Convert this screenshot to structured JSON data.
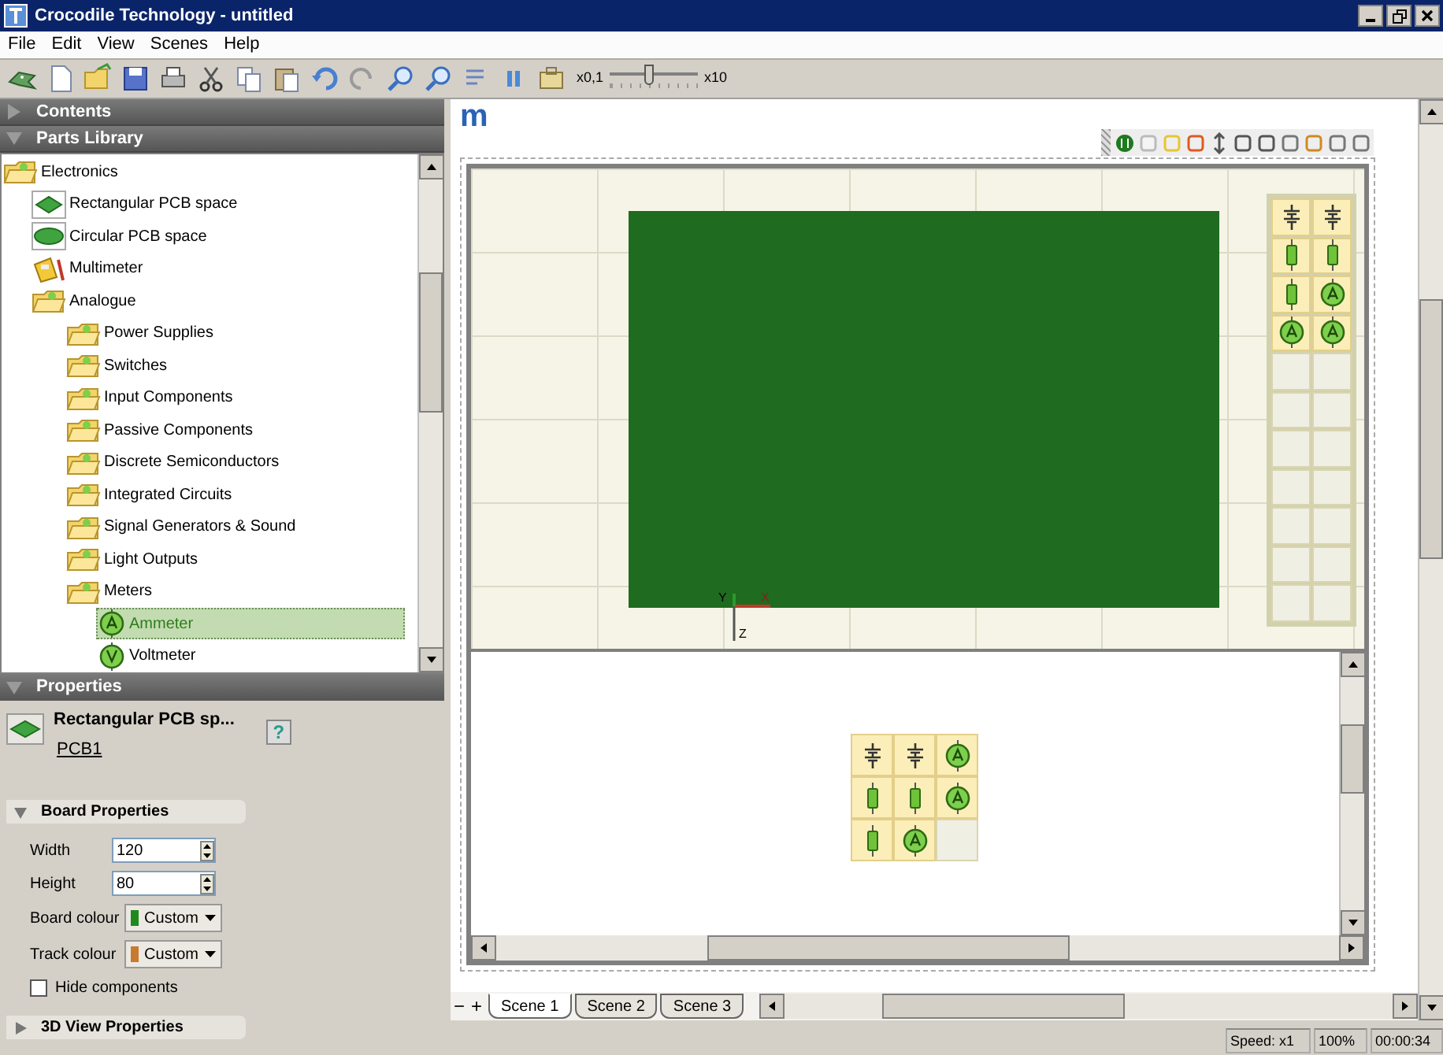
{
  "window": {
    "title": "Crocodile Technology - untitled"
  },
  "menu": [
    "File",
    "Edit",
    "View",
    "Scenes",
    "Help"
  ],
  "toolbar": {
    "speed_min": "x0,1",
    "speed_max": "x10",
    "speed_slider": {
      "level": 0.45
    }
  },
  "sidebar_sections": [
    {
      "title": "Contents",
      "expanded": false
    },
    {
      "title": "Parts Library",
      "expanded": true
    }
  ],
  "parts_tree": [
    {
      "label": "Electronics",
      "kind": "folder",
      "selected": false,
      "children": [
        {
          "label": "Rectangular PCB space",
          "kind": "pcb-rect",
          "selected": false
        },
        {
          "label": "Circular PCB space",
          "kind": "pcb-circle",
          "selected": false
        },
        {
          "label": "Multimeter",
          "kind": "multimeter",
          "selected": false
        },
        {
          "label": "Analogue",
          "kind": "folder",
          "selected": false,
          "children": [
            {
              "label": "Power Supplies",
              "kind": "folder",
              "selected": false
            },
            {
              "label": "Switches",
              "kind": "folder",
              "selected": false
            },
            {
              "label": "Input Components",
              "kind": "folder",
              "selected": false
            },
            {
              "label": "Passive Components",
              "kind": "folder",
              "selected": false
            },
            {
              "label": "Discrete Semiconductors",
              "kind": "folder",
              "selected": false
            },
            {
              "label": "Integrated Circuits",
              "kind": "folder",
              "selected": false
            },
            {
              "label": "Signal Generators & Sound",
              "kind": "folder",
              "selected": false
            },
            {
              "label": "Light Outputs",
              "kind": "folder",
              "selected": false
            },
            {
              "label": "Meters",
              "kind": "folder",
              "selected": false,
              "children": [
                {
                  "label": "Ammeter",
                  "kind": "ammeter",
                  "selected": true
                },
                {
                  "label": "Voltmeter",
                  "kind": "voltmeter",
                  "selected": false
                }
              ]
            }
          ]
        }
      ]
    }
  ],
  "properties": {
    "title": "Properties",
    "name": "Rectangular PCB sp...",
    "id": "PCB1",
    "help": "?",
    "board_properties": {
      "title": "Board Properties",
      "expanded": true,
      "fields": [
        {
          "label": "Width",
          "value": "120"
        },
        {
          "label": "Height",
          "value": "80"
        }
      ],
      "colours": [
        {
          "label": "Board colour",
          "value": "Custom",
          "color": "#1e8a1e"
        },
        {
          "label": "Track colour",
          "value": "Custom",
          "color": "#c87a30"
        }
      ],
      "hide_components": {
        "label": "Hide components",
        "checked": false
      }
    },
    "view_3d": {
      "title": "3D View Properties",
      "expanded": false
    }
  },
  "canvas": {
    "logo": "m",
    "axes": {
      "y": "Y",
      "x": "X",
      "z": "Z"
    },
    "bin_3d": [
      [
        {
          "kind": "battery"
        },
        {
          "kind": "battery"
        }
      ],
      [
        {
          "kind": "resistor"
        },
        {
          "kind": "resistor"
        }
      ],
      [
        {
          "kind": "resistor"
        },
        {
          "kind": "ammeter"
        }
      ],
      [
        {
          "kind": "ammeter"
        },
        {
          "kind": "ammeter"
        }
      ],
      [
        {
          "kind": "empty"
        },
        {
          "kind": "empty"
        }
      ],
      [
        {
          "kind": "empty"
        },
        {
          "kind": "empty"
        }
      ],
      [
        {
          "kind": "empty"
        },
        {
          "kind": "empty"
        }
      ],
      [
        {
          "kind": "empty"
        },
        {
          "kind": "empty"
        }
      ],
      [
        {
          "kind": "empty"
        },
        {
          "kind": "empty"
        }
      ],
      [
        {
          "kind": "empty"
        },
        {
          "kind": "empty"
        }
      ],
      [
        {
          "kind": "empty"
        },
        {
          "kind": "empty"
        }
      ]
    ],
    "bin_2d": [
      [
        {
          "kind": "battery"
        },
        {
          "kind": "battery"
        },
        {
          "kind": "ammeter"
        }
      ],
      [
        {
          "kind": "resistor"
        },
        {
          "kind": "resistor"
        },
        {
          "kind": "ammeter"
        }
      ],
      [
        {
          "kind": "resistor"
        },
        {
          "kind": "ammeter"
        },
        {
          "kind": "empty"
        }
      ]
    ]
  },
  "scene_controls": [
    "−",
    "+"
  ],
  "scene_tabs": [
    {
      "label": "Scene 1",
      "selected": true
    },
    {
      "label": "Scene 2",
      "selected": false
    },
    {
      "label": "Scene 3",
      "selected": false
    }
  ],
  "status_bar": [
    "Speed: x1",
    "100%",
    "00:00:34"
  ]
}
